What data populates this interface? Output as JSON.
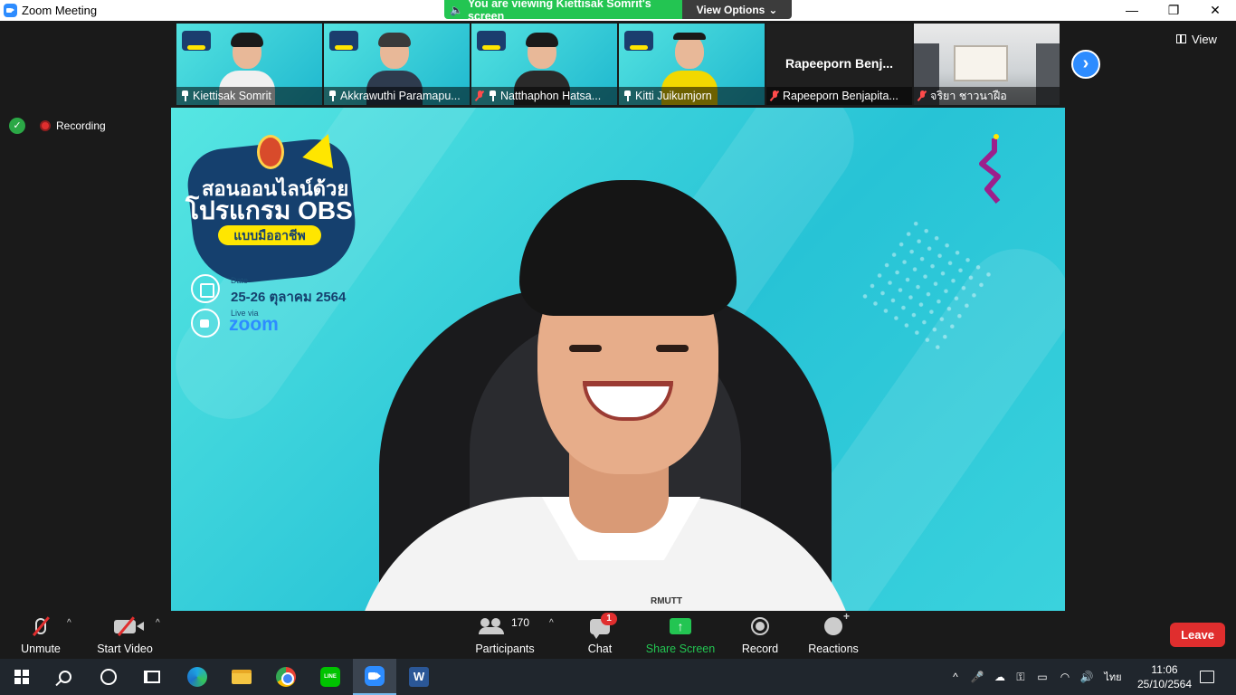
{
  "window": {
    "title": "Zoom Meeting",
    "minimize": "—",
    "restore": "❐",
    "close": "✕"
  },
  "share_banner": {
    "text": "You are viewing Kiettisak Somrit's screen",
    "view_options": "View Options",
    "caret": "⌄"
  },
  "gallery": {
    "tiles": [
      {
        "name": "Kiettisak Somrit",
        "pinned": true,
        "muted": false
      },
      {
        "name": "Akkrawuthi Paramapu...",
        "pinned": true,
        "muted": false
      },
      {
        "name": "Natthaphon Hatsa...",
        "pinned": true,
        "muted": true
      },
      {
        "name": "Kitti Juikumjorn",
        "pinned": true,
        "muted": false
      },
      {
        "name": "Rapeeporn Benjapita...",
        "big_name": "Rapeeporn  Benj...",
        "pinned": false,
        "muted": true
      },
      {
        "name": "จริยา ชาวนาฝือ",
        "pinned": false,
        "muted": true
      }
    ],
    "next_arrow": "›",
    "view_label": "View"
  },
  "status": {
    "shield": "✓",
    "recording_label": "Recording"
  },
  "main_video": {
    "poster_title_1": "สอนออนไลน์ด้วย",
    "poster_title_2": "โปรแกรม OBS",
    "poster_pill": "แบบมืออาชีพ",
    "date_small": "Date",
    "date_text": "25-26 ตุลาคม 2564",
    "live_small": "Live via",
    "zoom_text": "zoom",
    "shirt_logo": "RMUTT"
  },
  "toolbar": {
    "unmute": "Unmute",
    "start_video": "Start Video",
    "participants": "Participants",
    "participant_count": "170",
    "chat": "Chat",
    "chat_badge": "1",
    "share_screen": "Share Screen",
    "record": "Record",
    "reactions": "Reactions",
    "leave": "Leave",
    "caret_up": "^"
  },
  "taskbar": {
    "line_label": "LINE",
    "word_label": "W",
    "language": "ไทย",
    "time": "11:06",
    "date": "25/10/2564",
    "tray_chevron": "^"
  },
  "colors": {
    "zoom_blue": "#2d8cff",
    "share_green": "#23c552",
    "leave_red": "#e02e2e"
  }
}
